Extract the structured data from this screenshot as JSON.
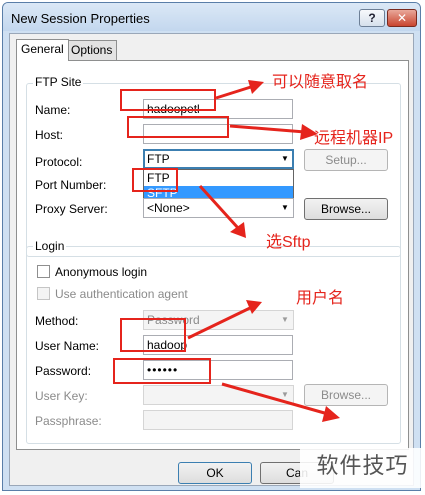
{
  "window": {
    "title": "New Session Properties",
    "help_label": "?",
    "close_label": "✕"
  },
  "tabs": [
    {
      "label": "General",
      "active": true
    },
    {
      "label": "Options",
      "active": false
    }
  ],
  "ftp_site": {
    "group_title": "FTP Site",
    "name_label": "Name:",
    "name_value": "hadoopetl",
    "host_label": "Host:",
    "protocol_label": "Protocol:",
    "protocol_value": "FTP",
    "protocol_options": [
      "FTP",
      "SFTP"
    ],
    "setup_label": "Setup...",
    "port_label": "Port Number:",
    "proxy_label": "Proxy Server:",
    "proxy_value": "<None>",
    "browse_label": "Browse..."
  },
  "login": {
    "group_title": "Login",
    "anonymous_label": "Anonymous login",
    "auth_agent_label": "Use authentication agent",
    "method_label": "Method:",
    "method_value": "Password",
    "username_label": "User Name:",
    "username_value": "hadoop",
    "password_label": "Password:",
    "password_value": "••••••",
    "userkey_label": "User Key:",
    "browse_label": "Browse...",
    "passphrase_label": "Passphrase:"
  },
  "footer": {
    "ok_label": "OK",
    "cancel_label": "Can"
  },
  "annotations": {
    "name_note": "可以随意取名",
    "host_note": "远程机器IP",
    "protocol_note": "选Sftp",
    "user_note": "用户名",
    "color": "#e5241c"
  },
  "watermark": "软件技巧"
}
